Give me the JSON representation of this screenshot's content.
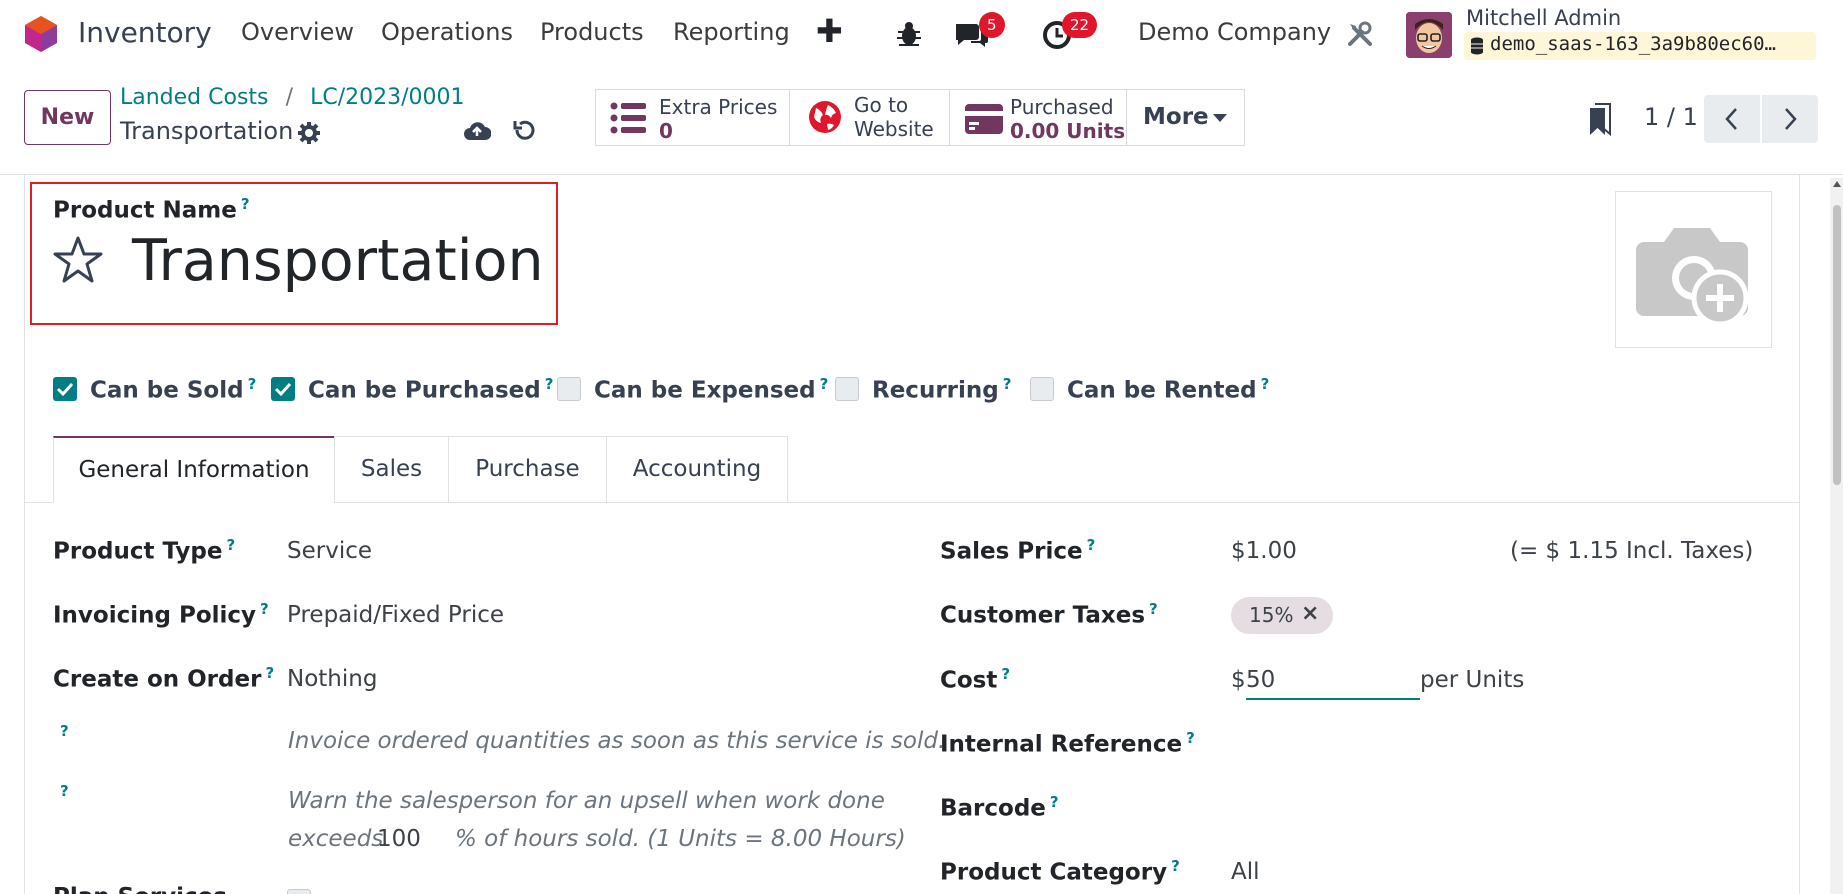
{
  "navbar": {
    "app_name": "Inventory",
    "menu": [
      "Overview",
      "Operations",
      "Products",
      "Reporting"
    ],
    "messages_count": "5",
    "activities_count": "22",
    "company": "Demo Company",
    "user_name": "Mitchell Admin",
    "database": "demo_saas-163_3a9b80ec60…"
  },
  "control_panel": {
    "new_label": "New",
    "breadcrumb": [
      "Landed Costs",
      "LC/2023/0001"
    ],
    "record_title": "Transportation",
    "separator": "/",
    "smart_buttons": {
      "extra_prices_label": "Extra Prices",
      "extra_prices_value": "0",
      "website_line1": "Go to",
      "website_line2": "Website",
      "purchased_label": "Purchased",
      "purchased_value": "0.00 Units",
      "more_label": "More"
    },
    "pager": "1 / 1"
  },
  "form": {
    "product_name_label": "Product Name",
    "product_name": "Transportation",
    "help_mark": "?",
    "checkboxes": [
      {
        "label": "Can be Sold",
        "checked": true
      },
      {
        "label": "Can be Purchased",
        "checked": true
      },
      {
        "label": "Can be Expensed",
        "checked": false
      },
      {
        "label": "Recurring",
        "checked": false
      },
      {
        "label": "Can be Rented",
        "checked": false
      }
    ],
    "tabs": [
      "General Information",
      "Sales",
      "Purchase",
      "Accounting"
    ],
    "left": {
      "product_type_label": "Product Type",
      "product_type": "Service",
      "invoicing_policy_label": "Invoicing Policy",
      "invoicing_policy": "Prepaid/Fixed Price",
      "create_on_order_label": "Create on Order",
      "create_on_order": "Nothing",
      "invoice_note": "Invoice ordered quantities as soon as this service is sold.",
      "upsell_line1": "Warn the salesperson for an upsell when work done",
      "upsell_exceeds": "exceeds",
      "upsell_value": "100",
      "upsell_line2_end": "% of hours sold. (1 Units = 8.00 Hours)",
      "plan_services_label": "Plan Services"
    },
    "right": {
      "sales_price_label": "Sales Price",
      "sales_price": "$1.00",
      "incl_taxes": "(= $ 1.15 Incl. Taxes)",
      "customer_taxes_label": "Customer Taxes",
      "tax_tag": "15%",
      "cost_label": "Cost",
      "cost_currency": "$",
      "cost_value": "50",
      "cost_unit": "per Units",
      "internal_ref_label": "Internal Reference",
      "barcode_label": "Barcode",
      "category_label": "Product Category",
      "category": "All"
    }
  },
  "colors": {
    "brand": "#71375e",
    "teal": "#017e84",
    "badge": "#e0162b",
    "highlight_border": "#dc1f26"
  }
}
